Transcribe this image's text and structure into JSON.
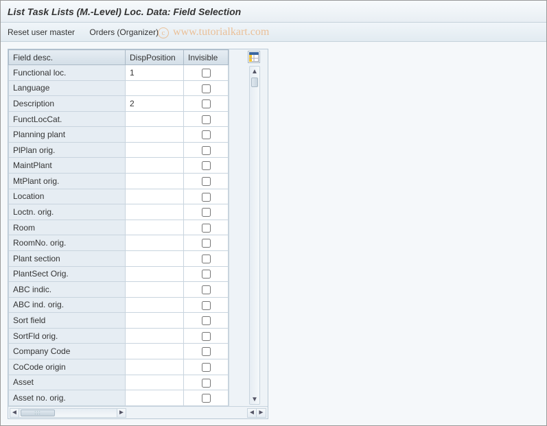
{
  "title": "List Task Lists (M.-Level) Loc. Data: Field Selection",
  "toolbar": {
    "reset_user_master": "Reset user master",
    "orders_organizer": "Orders (Organizer)"
  },
  "table": {
    "headers": {
      "field_desc": "Field desc.",
      "disp_position": "DispPosition",
      "invisible": "Invisible"
    },
    "rows": [
      {
        "desc": "Functional loc.",
        "pos": "1",
        "invisible": false
      },
      {
        "desc": "Language",
        "pos": "",
        "invisible": false
      },
      {
        "desc": "Description",
        "pos": "2",
        "invisible": false
      },
      {
        "desc": "FunctLocCat.",
        "pos": "",
        "invisible": false
      },
      {
        "desc": "Planning plant",
        "pos": "",
        "invisible": false
      },
      {
        "desc": "PlPlan orig.",
        "pos": "",
        "invisible": false
      },
      {
        "desc": "MaintPlant",
        "pos": "",
        "invisible": false
      },
      {
        "desc": "MtPlant orig.",
        "pos": "",
        "invisible": false
      },
      {
        "desc": "Location",
        "pos": "",
        "invisible": false
      },
      {
        "desc": "Loctn. orig.",
        "pos": "",
        "invisible": false
      },
      {
        "desc": "Room",
        "pos": "",
        "invisible": false
      },
      {
        "desc": "RoomNo. orig.",
        "pos": "",
        "invisible": false
      },
      {
        "desc": "Plant section",
        "pos": "",
        "invisible": false
      },
      {
        "desc": "PlantSect Orig.",
        "pos": "",
        "invisible": false
      },
      {
        "desc": "ABC indic.",
        "pos": "",
        "invisible": false
      },
      {
        "desc": "ABC ind. orig.",
        "pos": "",
        "invisible": false
      },
      {
        "desc": "Sort field",
        "pos": "",
        "invisible": false
      },
      {
        "desc": "SortFld orig.",
        "pos": "",
        "invisible": false
      },
      {
        "desc": "Company Code",
        "pos": "",
        "invisible": false
      },
      {
        "desc": "CoCode origin",
        "pos": "",
        "invisible": false
      },
      {
        "desc": "Asset",
        "pos": "",
        "invisible": false
      },
      {
        "desc": "Asset no. orig.",
        "pos": "",
        "invisible": false
      }
    ]
  },
  "icons": {
    "layout_button": "table-layout-icon"
  },
  "watermark": "www.tutorialkart.com"
}
